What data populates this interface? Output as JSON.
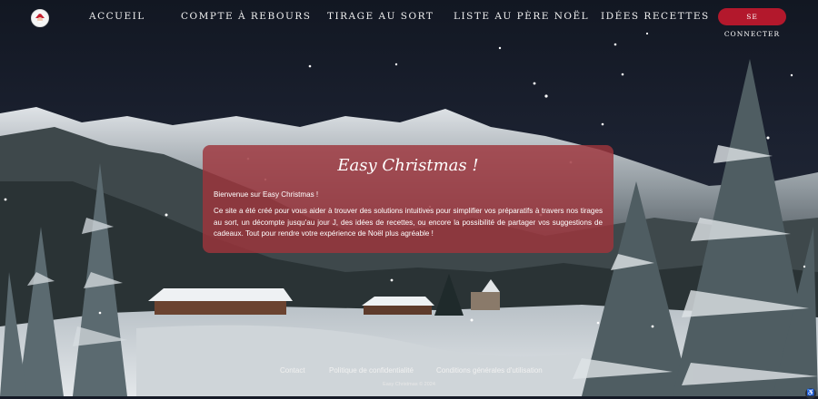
{
  "nav": {
    "logo_alt": "Easy Christmas",
    "items": [
      "Accueil",
      "Compte à rebours",
      "Tirage au sort",
      "Liste au Père Noël",
      "Idées recettes"
    ],
    "login_label": "Se connecter"
  },
  "card": {
    "title": "Easy Christmas !",
    "intro": "Bienvenue sur Easy Christmas !",
    "body": "Ce site a été créé pour vous aider à trouver des solutions intuitives pour simplifier vos préparatifs à travers nos tirages au sort, un décompte jusqu'au jour J, des idées de recettes, ou encore la possibilité de partager vos suggestions de cadeaux. Tout pour rendre votre expérience de Noël plus agréable !"
  },
  "footer": {
    "links": [
      "Contact",
      "Politique de confidentialité",
      "Conditions générales d'utilisation"
    ],
    "copyright": "Easy Christmas © 2024"
  },
  "colors": {
    "accent": "#b3182c",
    "card_bg": "#9e343c",
    "sky": "#151a26"
  },
  "icons": {
    "logo": "santa-logo-icon",
    "corner": "accessibility-icon"
  }
}
